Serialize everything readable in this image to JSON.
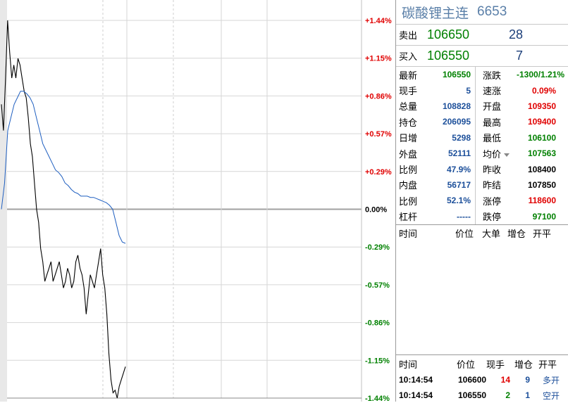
{
  "chart": {
    "pct_labels": [
      {
        "text": "+1.44%",
        "color": "#e00000"
      },
      {
        "text": "+1.15%",
        "color": "#e00000"
      },
      {
        "text": "+0.86%",
        "color": "#e00000"
      },
      {
        "text": "+0.57%",
        "color": "#e00000"
      },
      {
        "text": "+0.29%",
        "color": "#e00000"
      },
      {
        "text": "0.00%",
        "color": "#000000"
      },
      {
        "text": "-0.29%",
        "color": "#008000"
      },
      {
        "text": "-0.57%",
        "color": "#008000"
      },
      {
        "text": "-0.86%",
        "color": "#008000"
      },
      {
        "text": "-1.15%",
        "color": "#008000"
      },
      {
        "text": "-1.44%",
        "color": "#008000"
      }
    ],
    "price_line_color": "#000000",
    "avg_line_color": "#1f5fc0",
    "price_pct": [
      0.8,
      0.6,
      1.0,
      1.44,
      1.2,
      1.0,
      1.1,
      1.0,
      1.15,
      1.1,
      1.0,
      0.9,
      0.85,
      0.7,
      0.5,
      0.4,
      0.2,
      0.0,
      -0.1,
      -0.3,
      -0.4,
      -0.55,
      -0.5,
      -0.45,
      -0.4,
      -0.55,
      -0.5,
      -0.45,
      -0.4,
      -0.5,
      -0.6,
      -0.55,
      -0.45,
      -0.5,
      -0.6,
      -0.55,
      -0.4,
      -0.35,
      -0.45,
      -0.5,
      -0.6,
      -0.8,
      -0.65,
      -0.5,
      -0.55,
      -0.6,
      -0.5,
      -0.4,
      -0.3,
      -0.5,
      -0.6,
      -0.8,
      -1.1,
      -1.3,
      -1.4,
      -1.38,
      -1.44,
      -1.35,
      -1.3,
      -1.25,
      -1.2
    ],
    "avg_pct": [
      0.0,
      0.2,
      0.6,
      0.7,
      0.8,
      0.85,
      0.9,
      0.9,
      0.88,
      0.85,
      0.8,
      0.7,
      0.6,
      0.5,
      0.45,
      0.4,
      0.35,
      0.3,
      0.28,
      0.25,
      0.2,
      0.18,
      0.15,
      0.13,
      0.12,
      0.1,
      0.1,
      0.1,
      0.09,
      0.09,
      0.08,
      0.07,
      0.06,
      0.05,
      0.03,
      0.0,
      -0.1,
      -0.2,
      -0.25,
      -0.26
    ]
  },
  "panel": {
    "title": "碳酸锂主连",
    "code": "6653",
    "sell": {
      "label": "卖出",
      "price": "106650",
      "qty": "28"
    },
    "buy": {
      "label": "买入",
      "price": "106550",
      "qty": "7"
    },
    "stats": [
      {
        "k1": "最新",
        "v1": "106550",
        "c1": "green",
        "k2": "涨跌",
        "v2": "-1300/1.21%",
        "c2": "green"
      },
      {
        "k1": "现手",
        "v1": "5",
        "c1": "blue",
        "k2": "速涨",
        "v2": "0.09%",
        "c2": "red"
      },
      {
        "k1": "总量",
        "v1": "108828",
        "c1": "blue",
        "k2": "开盘",
        "v2": "109350",
        "c2": "red"
      },
      {
        "k1": "持仓",
        "v1": "206095",
        "c1": "blue",
        "k2": "最高",
        "v2": "109400",
        "c2": "red"
      },
      {
        "k1": "日增",
        "v1": "5298",
        "c1": "blue",
        "k2": "最低",
        "v2": "106100",
        "c2": "green"
      },
      {
        "k1": "外盘",
        "v1": "52111",
        "c1": "blue",
        "k2": "均价",
        "v2": "107563",
        "c2": "green"
      },
      {
        "k1": "比例",
        "v1": "47.9%",
        "c1": "blue",
        "k2": "昨收",
        "v2": "108400",
        "c2": "black"
      },
      {
        "k1": "内盘",
        "v1": "56717",
        "c1": "blue",
        "k2": "昨结",
        "v2": "107850",
        "c2": "black"
      },
      {
        "k1": "比例",
        "v1": "52.1%",
        "c1": "blue",
        "k2": "涨停",
        "v2": "118600",
        "c2": "red"
      },
      {
        "k1": "杠杆",
        "v1": "-----",
        "c1": "blue",
        "k2": "跌停",
        "v2": "97100",
        "c2": "green"
      }
    ],
    "big_header": [
      "时间",
      "价位",
      "大单",
      "增仓",
      "开平"
    ],
    "trade_header": [
      "时间",
      "价位",
      "现手",
      "增仓",
      "开平"
    ],
    "trades": [
      {
        "time": "10:14:54",
        "price": "106600",
        "vol": "14",
        "vol_color": "red",
        "oi": "9",
        "type": "多开"
      },
      {
        "time": "10:14:54",
        "price": "106550",
        "vol": "2",
        "vol_color": "green",
        "oi": "1",
        "type": "空开"
      }
    ]
  }
}
